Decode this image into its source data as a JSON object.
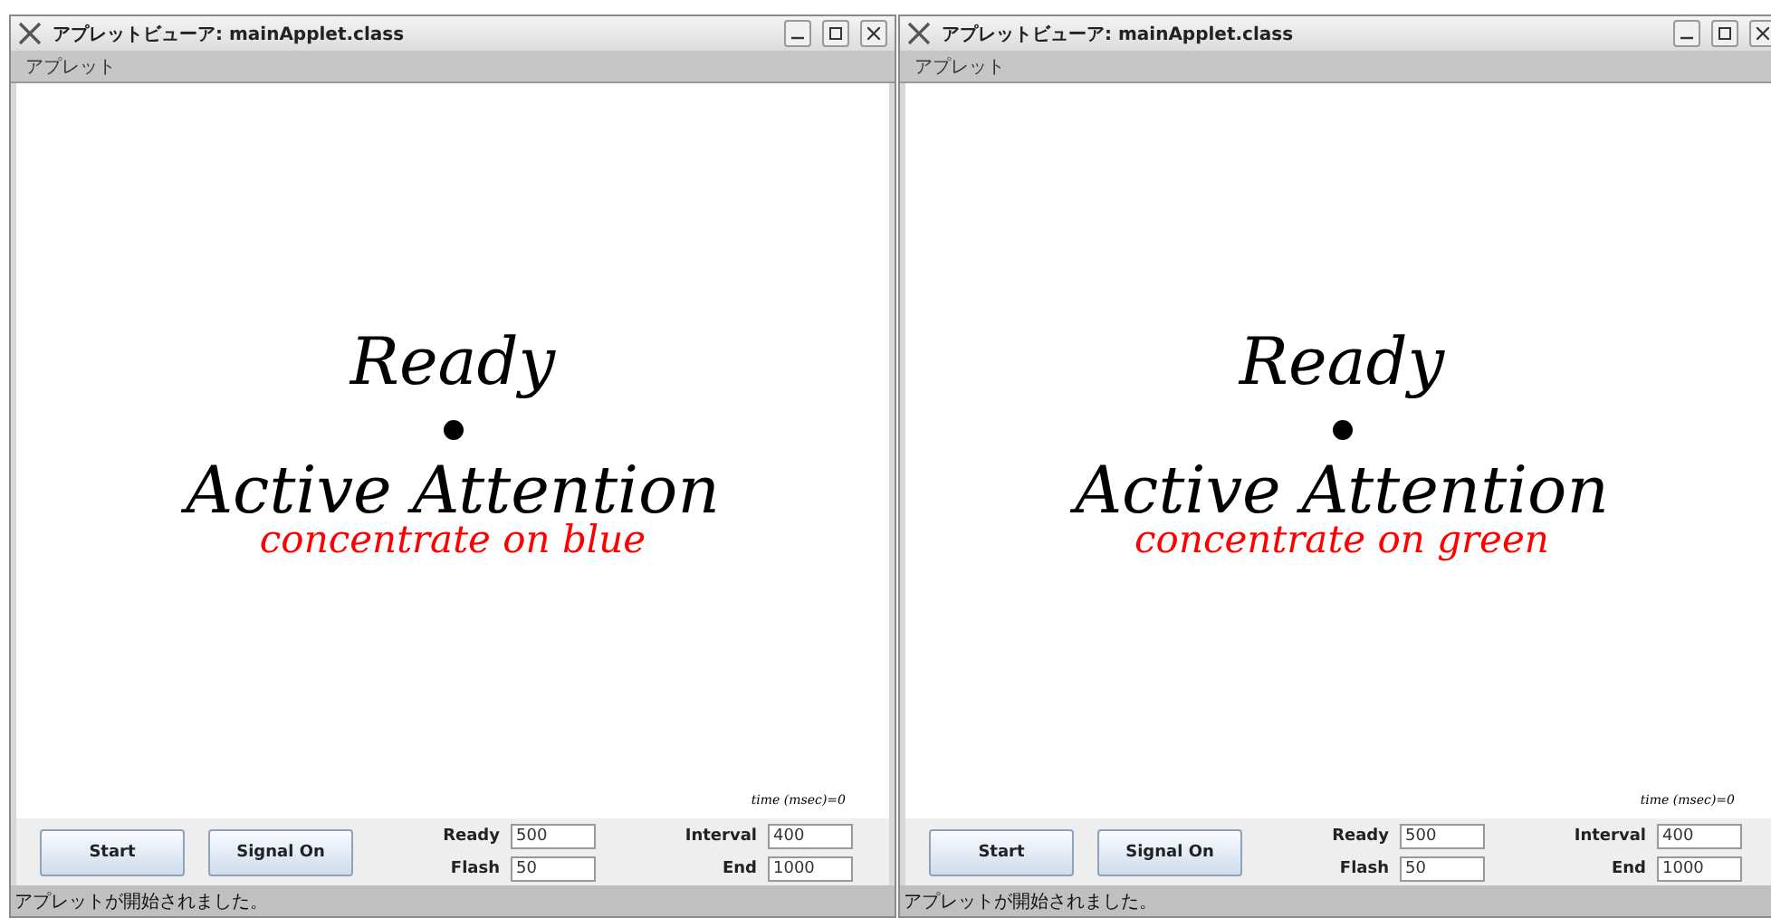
{
  "windows": [
    {
      "title": "アプレットビューア: mainApplet.class",
      "menu": [
        "アプレット"
      ],
      "canvas": {
        "heading": "Ready",
        "title": "Active Attention",
        "instruction": "concentrate on blue",
        "time": "time (msec)=0"
      },
      "buttons": [
        "Start",
        "Signal On"
      ],
      "fields": [
        {
          "label": "Ready",
          "value": "500"
        },
        {
          "label": "Flash",
          "value": "50"
        },
        {
          "label": "Interval",
          "value": "400"
        },
        {
          "label": "End",
          "value": "1000"
        }
      ],
      "status": "アプレットが開始されました。"
    },
    {
      "title": "アプレットビューア: mainApplet.class",
      "menu": [
        "アプレット"
      ],
      "canvas": {
        "heading": "Ready",
        "title": "Active Attention",
        "instruction": "concentrate on green",
        "time": "time (msec)=0"
      },
      "buttons": [
        "Start",
        "Signal On"
      ],
      "fields": [
        {
          "label": "Ready",
          "value": "500"
        },
        {
          "label": "Flash",
          "value": "50"
        },
        {
          "label": "Interval",
          "value": "400"
        },
        {
          "label": "End",
          "value": "1000"
        }
      ],
      "status": "アプレットが開始されました。"
    }
  ]
}
